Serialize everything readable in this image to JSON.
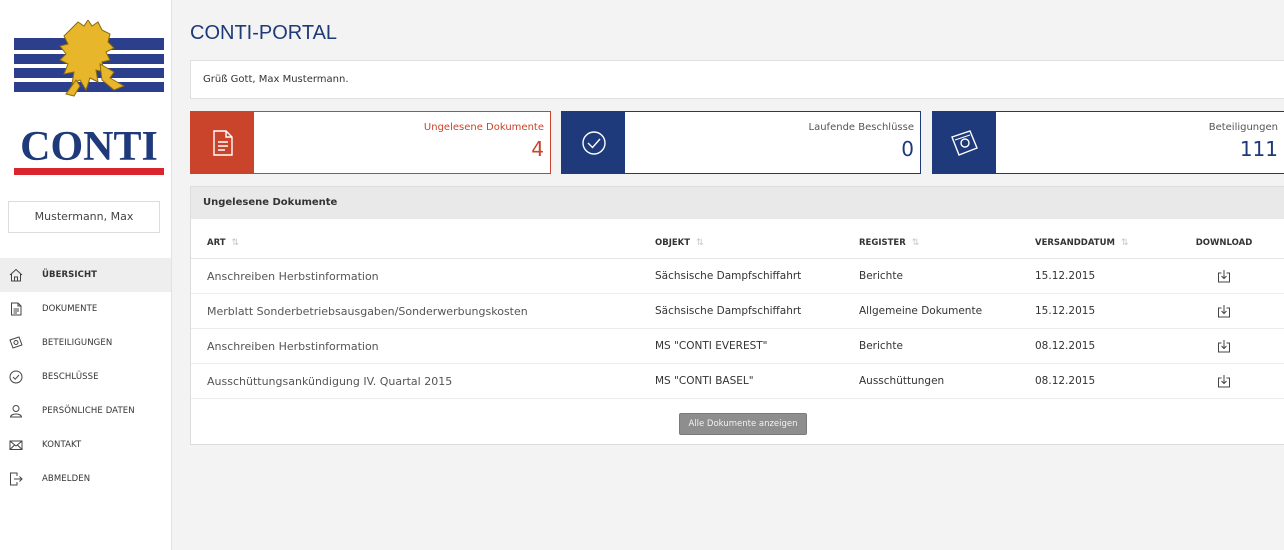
{
  "app": {
    "logo_text": "CONTI",
    "page_title": "CONTI-PORTAL",
    "greeting": "Grüß Gott, Max Mustermann."
  },
  "colors": {
    "brand_blue": "#1e3a7a",
    "accent_red": "#c9442a",
    "logo_stripe_blue": "#2b3f8c"
  },
  "sidebar": {
    "user_name": "Mustermann, Max",
    "items": [
      {
        "label": "ÜBERSICHT",
        "icon": "home-icon",
        "active": true
      },
      {
        "label": "DOKUMENTE",
        "icon": "document-icon",
        "active": false
      },
      {
        "label": "BETEILIGUNGEN",
        "icon": "money-icon",
        "active": false
      },
      {
        "label": "BESCHLÜSSE",
        "icon": "check-circle-icon",
        "active": false
      },
      {
        "label": "PERSÖNLICHE DATEN",
        "icon": "user-icon",
        "active": false
      },
      {
        "label": "KONTAKT",
        "icon": "mail-icon",
        "active": false
      },
      {
        "label": "ABMELDEN",
        "icon": "logout-icon",
        "active": false
      }
    ]
  },
  "cards": [
    {
      "label": "Ungelesene Dokumente",
      "value": "4",
      "icon": "document-icon"
    },
    {
      "label": "Laufende Beschlüsse",
      "value": "0",
      "icon": "check-circle-icon"
    },
    {
      "label": "Beteiligungen",
      "value": "111",
      "icon": "money-icon"
    }
  ],
  "panel": {
    "title": "Ungelesene Dokumente",
    "columns": [
      "ART",
      "OBJEKT",
      "REGISTER",
      "VERSANDDATUM",
      "DOWNLOAD"
    ],
    "rows": [
      {
        "art": "Anschreiben Herbstinformation",
        "objekt": "Sächsische Dampfschiffahrt",
        "register": "Berichte",
        "datum": "15.12.2015"
      },
      {
        "art": "Merblatt Sonderbetriebsausgaben/Sonderwerbungskosten",
        "objekt": "Sächsische Dampfschiffahrt",
        "register": "Allgemeine Dokumente",
        "datum": "15.12.2015"
      },
      {
        "art": "Anschreiben Herbstinformation",
        "objekt": "MS \"CONTI EVEREST\"",
        "register": "Berichte",
        "datum": "08.12.2015"
      },
      {
        "art": "Ausschüttungsankündigung IV. Quartal 2015",
        "objekt": "MS \"CONTI BASEL\"",
        "register": "Ausschüttungen",
        "datum": "08.12.2015"
      }
    ],
    "show_all_label": "Alle Dokumente anzeigen"
  }
}
